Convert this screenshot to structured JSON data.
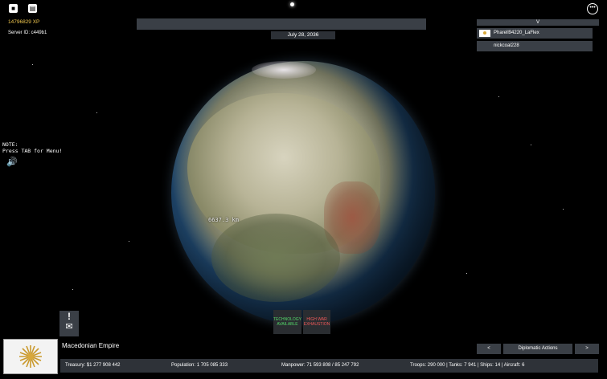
{
  "hud": {
    "xp": "14796829 XP",
    "server_id": "Server ID: c449b1",
    "note": "NOTE:\nPress TAB for Menu!",
    "speaker_icon": "speaker-icon",
    "menu_icon": "more-dots-icon"
  },
  "globe": {
    "distance_label": "6637.3 km"
  },
  "top": {
    "date": "July 28, 2036"
  },
  "players": {
    "toggle_label": "V",
    "list": [
      {
        "name": "Pharell94220_LaFlex",
        "has_flag": true
      },
      {
        "name": "nickcoal228",
        "has_flag": false
      }
    ]
  },
  "notifications": {
    "alert_mark": "!",
    "mail_icon": "envelope-icon",
    "technology": "TECHNOLOGY AVAILABLE",
    "war": "HIGH WAR EXHAUSTION"
  },
  "nation": {
    "name": "Macedonian Empire",
    "flag_icon": "vergina-sun-flag"
  },
  "stats": {
    "treasury": "Treasury:  $1 277 908 442",
    "population": "Population: 1 705 085 333",
    "manpower": "Manpower:  71 593 808  /  85 247 792",
    "military": "Troops: 290 000  |  Tanks: 7 941  |  Ships: 14  |  Aircraft: 6"
  },
  "diplomacy": {
    "prev": "<",
    "label": "Diplomatic Actions",
    "next": ">"
  },
  "colors": {
    "panel": "#3a3f46",
    "xp": "#f1c84f",
    "tech": "#54d86a",
    "war": "#f05a5a"
  }
}
